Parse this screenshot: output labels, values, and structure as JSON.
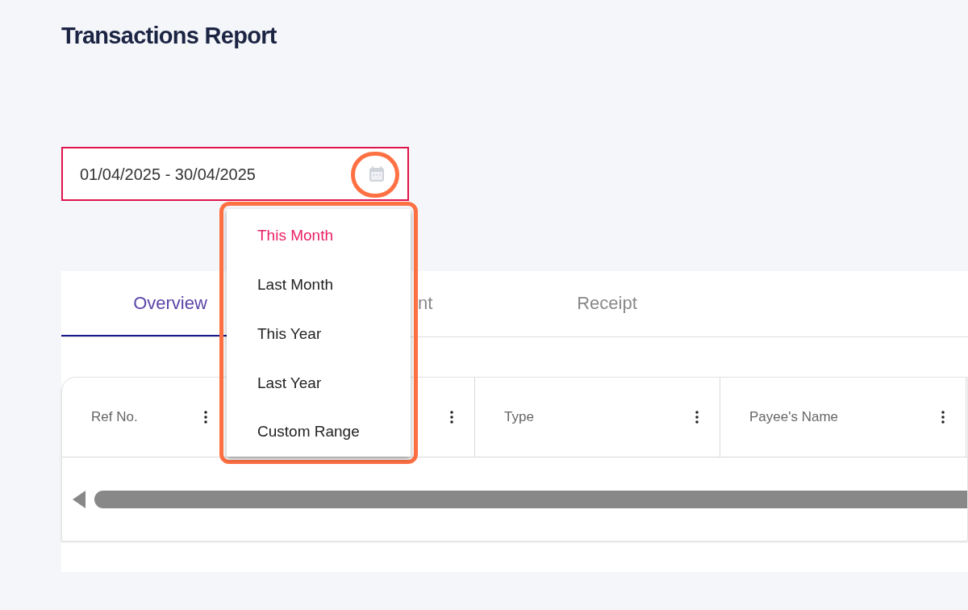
{
  "page": {
    "title": "Transactions Report"
  },
  "date_range": {
    "value": "01/04/2025 - 30/04/2025"
  },
  "range_menu": [
    {
      "label": "This Month",
      "selected": true
    },
    {
      "label": "Last Month",
      "selected": false
    },
    {
      "label": "This Year",
      "selected": false
    },
    {
      "label": "Last Year",
      "selected": false
    },
    {
      "label": "Custom Range",
      "selected": false
    }
  ],
  "tabs": [
    {
      "label": "Overview",
      "selected": true
    },
    {
      "label": "nt",
      "selected": false
    },
    {
      "label": "Receipt",
      "selected": false
    }
  ],
  "table": {
    "columns": [
      {
        "kind": "label",
        "label": "Ref No."
      },
      {
        "kind": "covered"
      },
      {
        "kind": "label",
        "label": "Type"
      },
      {
        "kind": "label",
        "label": "Payee's Name"
      },
      {
        "kind": "cut"
      }
    ]
  }
}
